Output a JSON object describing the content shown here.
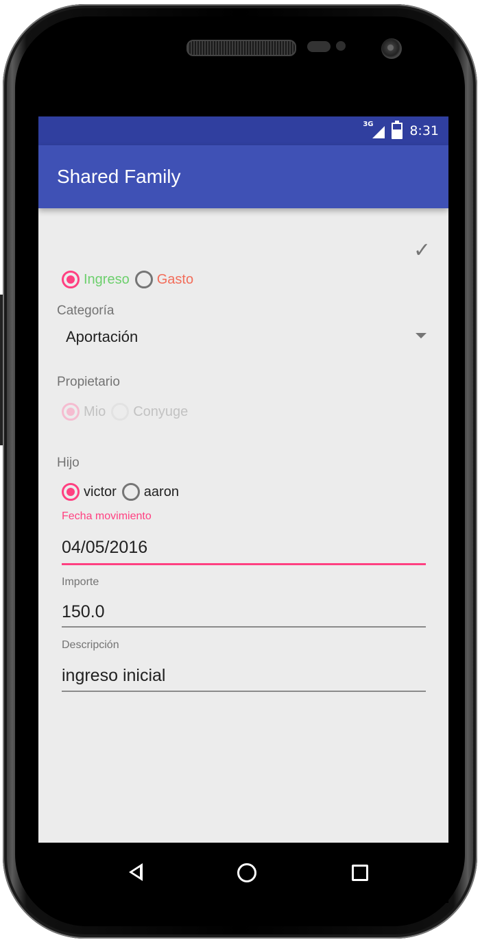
{
  "status_bar": {
    "network": "3G",
    "time": "8:31"
  },
  "app_bar": {
    "title": "Shared Family"
  },
  "toolbar": {
    "confirm_icon": "check-icon"
  },
  "movement_type": {
    "options": [
      {
        "label": "Ingreso",
        "selected": true,
        "color": "#6ccf6c"
      },
      {
        "label": "Gasto",
        "selected": false,
        "color": "#f26d5a"
      }
    ]
  },
  "category": {
    "label": "Categoría",
    "selected_value": "Aportación"
  },
  "owner": {
    "label": "Propietario",
    "enabled": false,
    "options": [
      {
        "label": "Mio",
        "selected": true
      },
      {
        "label": "Conyuge",
        "selected": false
      }
    ]
  },
  "child": {
    "label": "Hijo",
    "options": [
      {
        "label": "victor",
        "selected": true
      },
      {
        "label": "aaron",
        "selected": false
      }
    ]
  },
  "date_field": {
    "label": "Fecha movimiento",
    "value": "04/05/2016",
    "focused": true
  },
  "amount_field": {
    "label": "Importe",
    "value": "150.0"
  },
  "description_field": {
    "label": "Descripción",
    "value": "ingreso inicial"
  },
  "nav_bar": {
    "back_icon": "back-triangle-icon",
    "home_icon": "home-circle-icon",
    "recents_icon": "recents-square-icon"
  },
  "colors": {
    "primary": "#3f51b5",
    "primary_dark": "#303f9f",
    "accent": "#ff4081"
  }
}
